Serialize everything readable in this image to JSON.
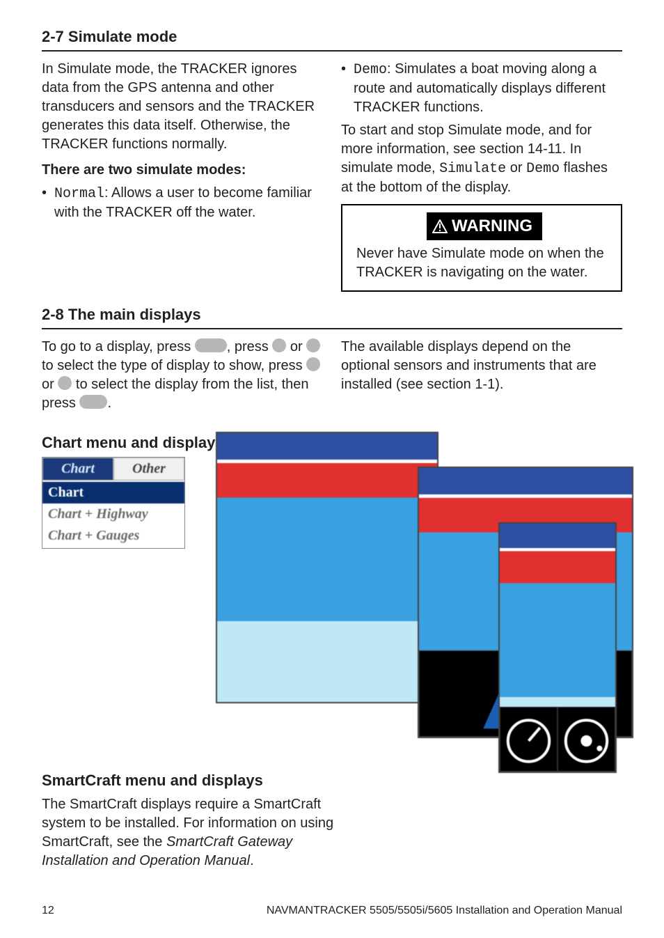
{
  "s27": {
    "title": "2-7 Simulate mode",
    "intro": "In Simulate mode, the TRACKER ignores data from the GPS antenna and other transducers and sensors and the TRACKER generates this data itself. Otherwise, the TRACKER functions normally.",
    "modes_heading": "There are two simulate modes:",
    "normal_label": "Normal",
    "normal_text": ": Allows a user to become familiar with the TRACKER off the water.",
    "demo_label": "Demo",
    "demo_text": ": Simulates a boat moving along a route and automatically displays different TRACKER functions.",
    "start_stop_a": "To start and stop Simulate mode, and for more information, see section 14-11. In simulate mode, ",
    "sim_word": "Simulate",
    "or_word": " or ",
    "demo_word": "Demo",
    "start_stop_b": " flashes at the bottom of the display.",
    "warning_label": "WARNING",
    "warning_text": "Never have Simulate mode on when the TRACKER is navigating on the water."
  },
  "s28": {
    "title": "2-8 The main displays",
    "left_a": "To go to a display, press ",
    "left_b": ", press ",
    "left_c": " or ",
    "left_d": " to select the type of display to show, press ",
    "left_e": " or ",
    "left_f": " to select the display from the list, then press ",
    "left_g": ".",
    "right": "The available displays depend on the optional sensors and instruments that are installed (see section 1-1)."
  },
  "chart_section": {
    "heading": "Chart menu and displays",
    "tab_active": "Chart",
    "tab_inactive": "Other",
    "items": [
      "Chart",
      "Chart + Highway",
      "Chart + Gauges"
    ]
  },
  "smartcraft": {
    "heading": "SmartCraft menu and displays",
    "text_a": "The SmartCraft displays require a SmartCraft system to be installed. For information on using SmartCraft, see the ",
    "text_ital": "SmartCraft Gateway Installation and Operation Manual",
    "text_b": "."
  },
  "footer": {
    "page": "12",
    "brand": "NAVMAN",
    "doc": "TRACKER 5505/5505i/5605 Installation and Operation Manual"
  }
}
